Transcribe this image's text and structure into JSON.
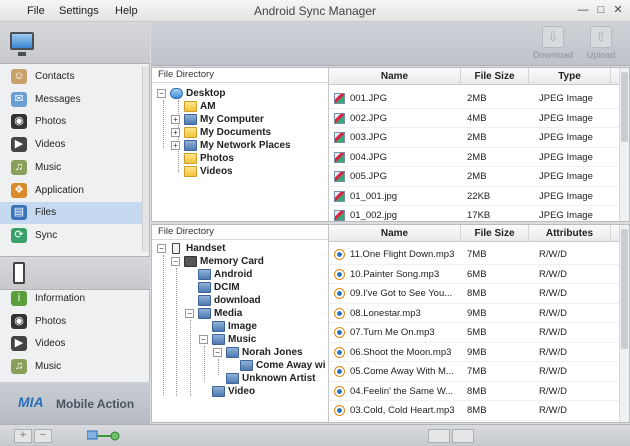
{
  "menu": {
    "file": "File",
    "settings": "Settings",
    "help": "Help"
  },
  "window": {
    "title": "Android Sync Manager",
    "min": "—",
    "max": "□",
    "close": "✕"
  },
  "computer_nav": [
    {
      "label": "Contacts",
      "icon": "contacts-icon"
    },
    {
      "label": "Messages",
      "icon": "messages-icon"
    },
    {
      "label": "Photos",
      "icon": "photos-icon"
    },
    {
      "label": "Videos",
      "icon": "videos-icon"
    },
    {
      "label": "Music",
      "icon": "music-icon"
    },
    {
      "label": "Application",
      "icon": "application-icon"
    },
    {
      "label": "Files",
      "icon": "files-icon",
      "selected": true
    },
    {
      "label": "Sync",
      "icon": "sync-icon"
    }
  ],
  "phone_nav": [
    {
      "label": "Information",
      "icon": "information-icon"
    },
    {
      "label": "Photos",
      "icon": "photos-icon"
    },
    {
      "label": "Videos",
      "icon": "videos-icon"
    },
    {
      "label": "Music",
      "icon": "music-icon"
    }
  ],
  "brand": {
    "logo": "MIA",
    "text": "Mobile Action"
  },
  "toolbar": {
    "download": "Download",
    "upload": "Upload"
  },
  "pc_pane": {
    "tree_header": "File Directory",
    "tree": [
      "Desktop",
      "AM",
      "My Computer",
      "My Documents",
      "My Network Places",
      "Photos",
      "Videos"
    ],
    "columns": [
      "Name",
      "File Size",
      "Type"
    ],
    "rows": [
      [
        "001.JPG",
        "2MB",
        "JPEG Image"
      ],
      [
        "002.JPG",
        "4MB",
        "JPEG Image"
      ],
      [
        "003.JPG",
        "2MB",
        "JPEG Image"
      ],
      [
        "004.JPG",
        "2MB",
        "JPEG Image"
      ],
      [
        "005.JPG",
        "2MB",
        "JPEG Image"
      ],
      [
        "01_001.jpg",
        "22KB",
        "JPEG Image"
      ],
      [
        "01_002.jpg",
        "17KB",
        "JPEG Image"
      ]
    ]
  },
  "phone_pane": {
    "tree_header": "File Directory",
    "tree": [
      "Handset",
      "Memory Card",
      "Android",
      "DCIM",
      "download",
      "Media",
      "Image",
      "Music",
      "Norah Jones",
      "Come Away wi",
      "Unknown Artist",
      "Video"
    ],
    "columns": [
      "Name",
      "File Size",
      "Attributes"
    ],
    "rows": [
      [
        "11.One Flight Down.mp3",
        "7MB",
        "R/W/D"
      ],
      [
        "10.Painter Song.mp3",
        "6MB",
        "R/W/D"
      ],
      [
        "09.I've Got to See You...",
        "8MB",
        "R/W/D"
      ],
      [
        "08.Lonestar.mp3",
        "9MB",
        "R/W/D"
      ],
      [
        "07.Turn Me On.mp3",
        "5MB",
        "R/W/D"
      ],
      [
        "06.Shoot the Moon.mp3",
        "9MB",
        "R/W/D"
      ],
      [
        "05.Come Away With M...",
        "7MB",
        "R/W/D"
      ],
      [
        "04.Feelin' the Same W...",
        "8MB",
        "R/W/D"
      ],
      [
        "03.Cold, Cold Heart.mp3",
        "8MB",
        "R/W/D"
      ]
    ]
  },
  "statusbar": {
    "add": "+",
    "remove": "−"
  },
  "colors": {
    "selected_row": "#c5d9f0",
    "accent": "#2c6fb6"
  }
}
